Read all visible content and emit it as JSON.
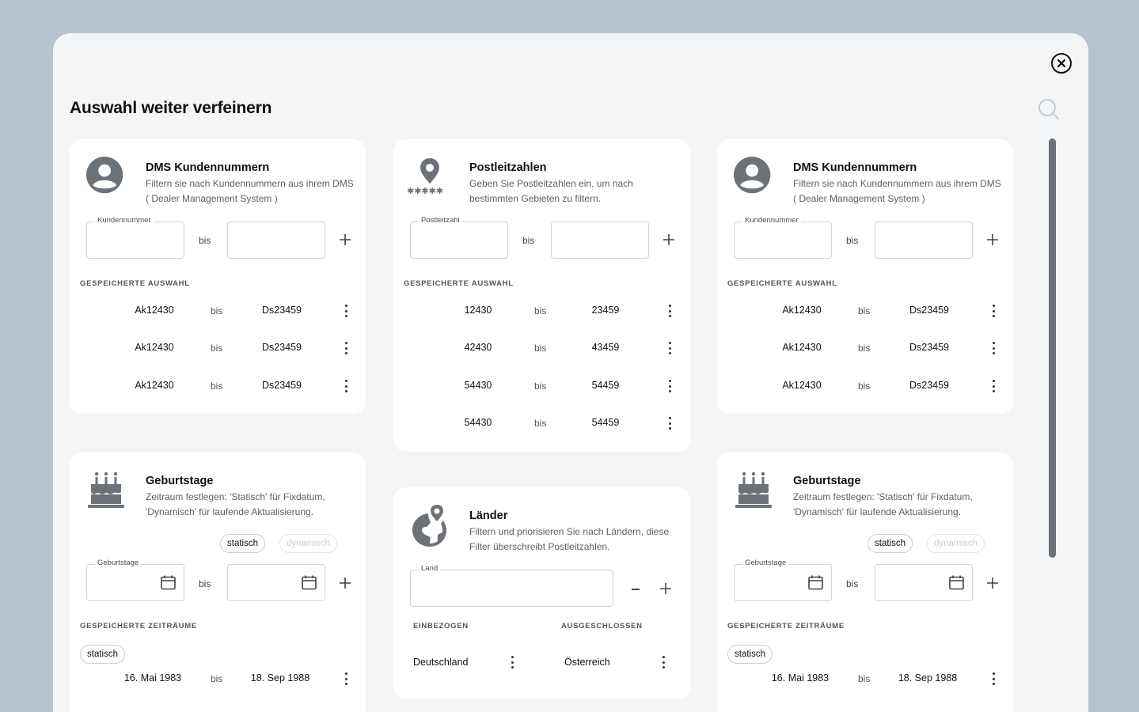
{
  "page": {
    "title": "Auswahl weiter verfeinern"
  },
  "icons": {
    "close": "close-circle-icon",
    "search": "search-icon"
  },
  "common": {
    "bis": "bis",
    "saved_selection": "GESPEICHERTE AUSWAHL",
    "saved_periods": "GESPEICHERTE ZEITRÄUME"
  },
  "dms": {
    "title": "DMS Kundennummern",
    "description": "Filtern sie nach Kundennummern aus ihrem DMS ( Dealer Management System )",
    "field_label": "Kundennummer",
    "rows": [
      {
        "from": "Ak12430",
        "to": "Ds23459"
      },
      {
        "from": "Ak12430",
        "to": "Ds23459"
      },
      {
        "from": "Ak12430",
        "to": "Ds23459"
      }
    ]
  },
  "plz": {
    "title": "Postleitzahlen",
    "description": "Geben Sie Postleitzahlen ein, um nach bestimmten Gebieten zu filtern.",
    "field_label": "Postleitzahl",
    "rows": [
      {
        "from": "12430",
        "to": "23459"
      },
      {
        "from": "42430",
        "to": "43459"
      },
      {
        "from": "54430",
        "to": "54459"
      },
      {
        "from": "54430",
        "to": "54459"
      }
    ]
  },
  "birthday": {
    "title": "Geburtstage",
    "description": "Zeitraum festlegen: 'Statisch' für Fixdatum, 'Dynamisch' für laufende Aktualisierung.",
    "toggle_static": "statisch",
    "toggle_dynamic": "dynamisch",
    "field_label": "Geburtstage",
    "saved_tag": "statisch",
    "saved_from": "16. Mai 1983",
    "saved_to": "18. Sep 1988"
  },
  "countries": {
    "title": "Länder",
    "description": "Filtern und priorisieren Sie nach Ländern, diese Filter überschreibt Postleitzahlen.",
    "field_label": "Land",
    "included_label": "EINBEZOGEN",
    "excluded_label": "AUSGESCHLOSSEN",
    "included_value": "Deutschland",
    "excluded_value": "Österreich"
  }
}
